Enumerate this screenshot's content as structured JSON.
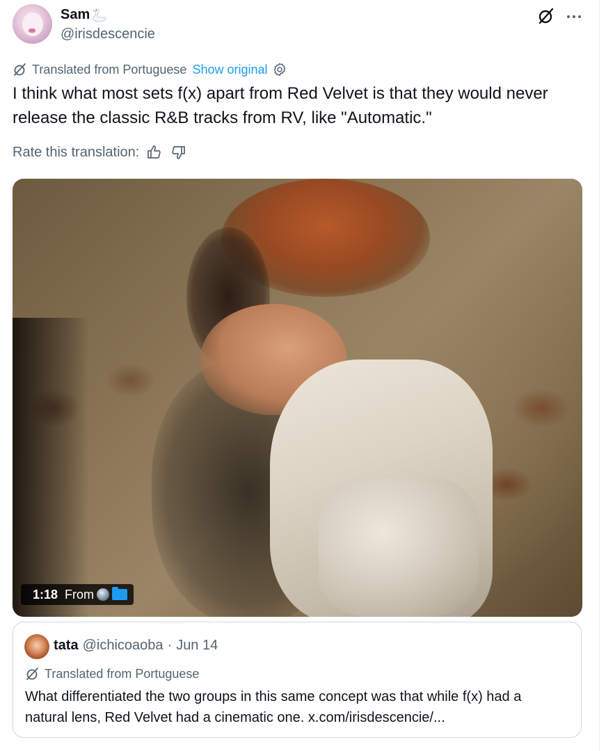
{
  "post": {
    "display_name": "Sam",
    "handle": "@irisdescencie",
    "translation_label": "Translated from Portuguese",
    "show_original": "Show original",
    "text": "I think what most sets f(x) apart from Red Velvet is that they would never release the classic R&B tracks from RV, like \"Automatic.\"",
    "rate_label": "Rate this translation:"
  },
  "video": {
    "duration": "1:18",
    "from_label": "From"
  },
  "quote": {
    "display_name": "tata",
    "handle": "@ichicoaoba",
    "separator": "·",
    "date": "Jun 14",
    "translation_label": "Translated from Portuguese",
    "text": "What differentiated the two groups in this same concept was that while f(x) had a natural lens, Red Velvet had a cinematic one. x.com/irisdescencie/..."
  },
  "colors": {
    "link": "#1d9bf0",
    "secondary_text": "#536471",
    "primary_text": "#0f1419",
    "border": "#cfd9de"
  },
  "icons": [
    "grok-icon",
    "more-icon",
    "translate-icon",
    "settings-icon",
    "thumbs-up-icon",
    "thumbs-down-icon",
    "swan-emoji",
    "globe-icon",
    "folder-icon"
  ]
}
